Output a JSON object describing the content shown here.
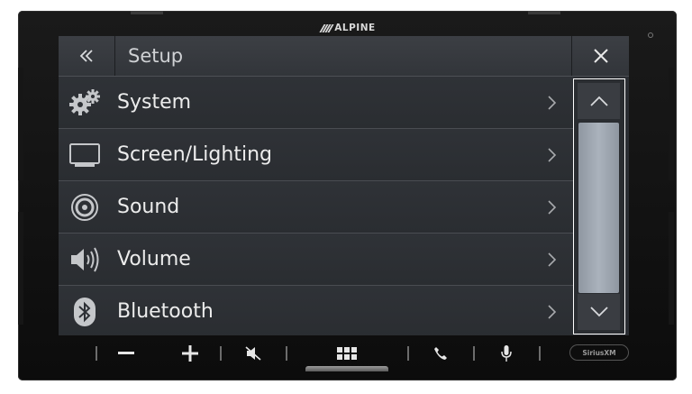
{
  "device": {
    "brand": "ALPINE",
    "badge": "SiriusXM"
  },
  "header": {
    "title": "Setup",
    "back_icon": "double-chevron-left-icon",
    "close_icon": "close-icon"
  },
  "menu": {
    "items": [
      {
        "label": "System",
        "icon": "gears-icon"
      },
      {
        "label": "Screen/Lighting",
        "icon": "monitor-icon"
      },
      {
        "label": "Sound",
        "icon": "speaker-icon"
      },
      {
        "label": "Volume",
        "icon": "volume-icon"
      },
      {
        "label": "Bluetooth",
        "icon": "bluetooth-icon"
      }
    ]
  },
  "scrollbar": {
    "position_fraction": 0.0,
    "visible_fraction": 0.8
  },
  "controls": {
    "buttons": [
      "volume-down-icon",
      "volume-up-icon",
      "mute-icon",
      "menu-grid-icon",
      "phone-icon",
      "microphone-icon"
    ]
  },
  "colors": {
    "screen_bg": "#2b2e33",
    "text": "#ececec",
    "scroll_thumb": "#a3abb5"
  }
}
